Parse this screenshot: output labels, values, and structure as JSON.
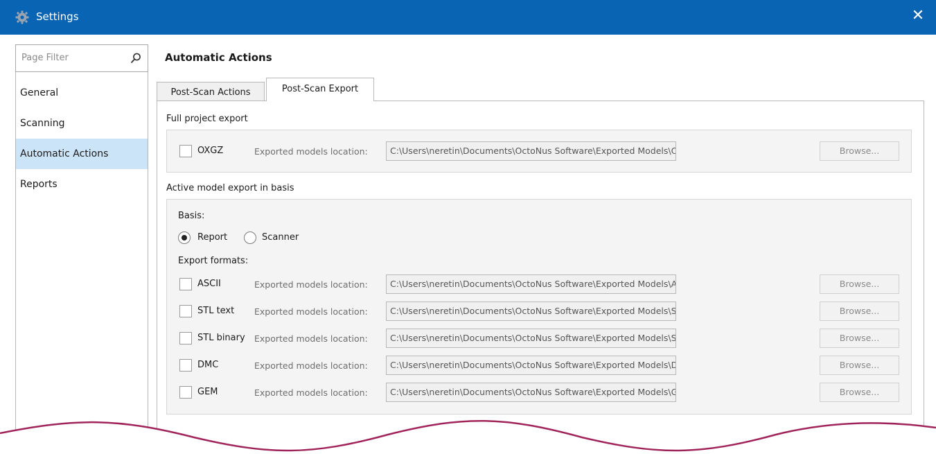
{
  "window": {
    "title": "Settings",
    "app_icon": "gear-icon",
    "close_icon": "close-icon",
    "accent": "#0a64b4"
  },
  "sidebar": {
    "filter_placeholder": "Page Filter",
    "items": [
      {
        "label": "General"
      },
      {
        "label": "Scanning"
      },
      {
        "label": "Automatic Actions",
        "active": true
      },
      {
        "label": "Reports"
      }
    ]
  },
  "page": {
    "title": "Automatic Actions",
    "tabs": [
      {
        "label": "Post-Scan Actions"
      },
      {
        "label": "Post-Scan Export",
        "active": true
      }
    ]
  },
  "full_export": {
    "group_label": "Full project export",
    "row": {
      "format": "OXGZ",
      "checked": false,
      "location_label": "Exported models location:",
      "path": "C:\\Users\\neretin\\Documents\\OctoNus Software\\Exported Models\\OXGZ",
      "browse": "Browse..."
    }
  },
  "active_export": {
    "group_label": "Active model export in basis",
    "basis_label": "Basis:",
    "basis_options": [
      {
        "label": "Report",
        "selected": true
      },
      {
        "label": "Scanner",
        "selected": false
      }
    ],
    "formats_label": "Export formats:",
    "rows": [
      {
        "format": "ASCII",
        "checked": false,
        "location_label": "Exported models location:",
        "path": "C:\\Users\\neretin\\Documents\\OctoNus Software\\Exported Models\\ASCII",
        "browse": "Browse..."
      },
      {
        "format": "STL text",
        "checked": false,
        "location_label": "Exported models location:",
        "path": "C:\\Users\\neretin\\Documents\\OctoNus Software\\Exported Models\\STL_TEXT",
        "browse": "Browse..."
      },
      {
        "format": "STL binary",
        "checked": false,
        "location_label": "Exported models location:",
        "path": "C:\\Users\\neretin\\Documents\\OctoNus Software\\Exported Models\\STL_BINARY",
        "browse": "Browse..."
      },
      {
        "format": "DMC",
        "checked": false,
        "location_label": "Exported models location:",
        "path": "C:\\Users\\neretin\\Documents\\OctoNus Software\\Exported Models\\DMC",
        "browse": "Browse..."
      },
      {
        "format": "GEM",
        "checked": false,
        "location_label": "Exported models location:",
        "path": "C:\\Users\\neretin\\Documents\\OctoNus Software\\Exported Models\\GEM",
        "browse": "Browse..."
      }
    ]
  }
}
